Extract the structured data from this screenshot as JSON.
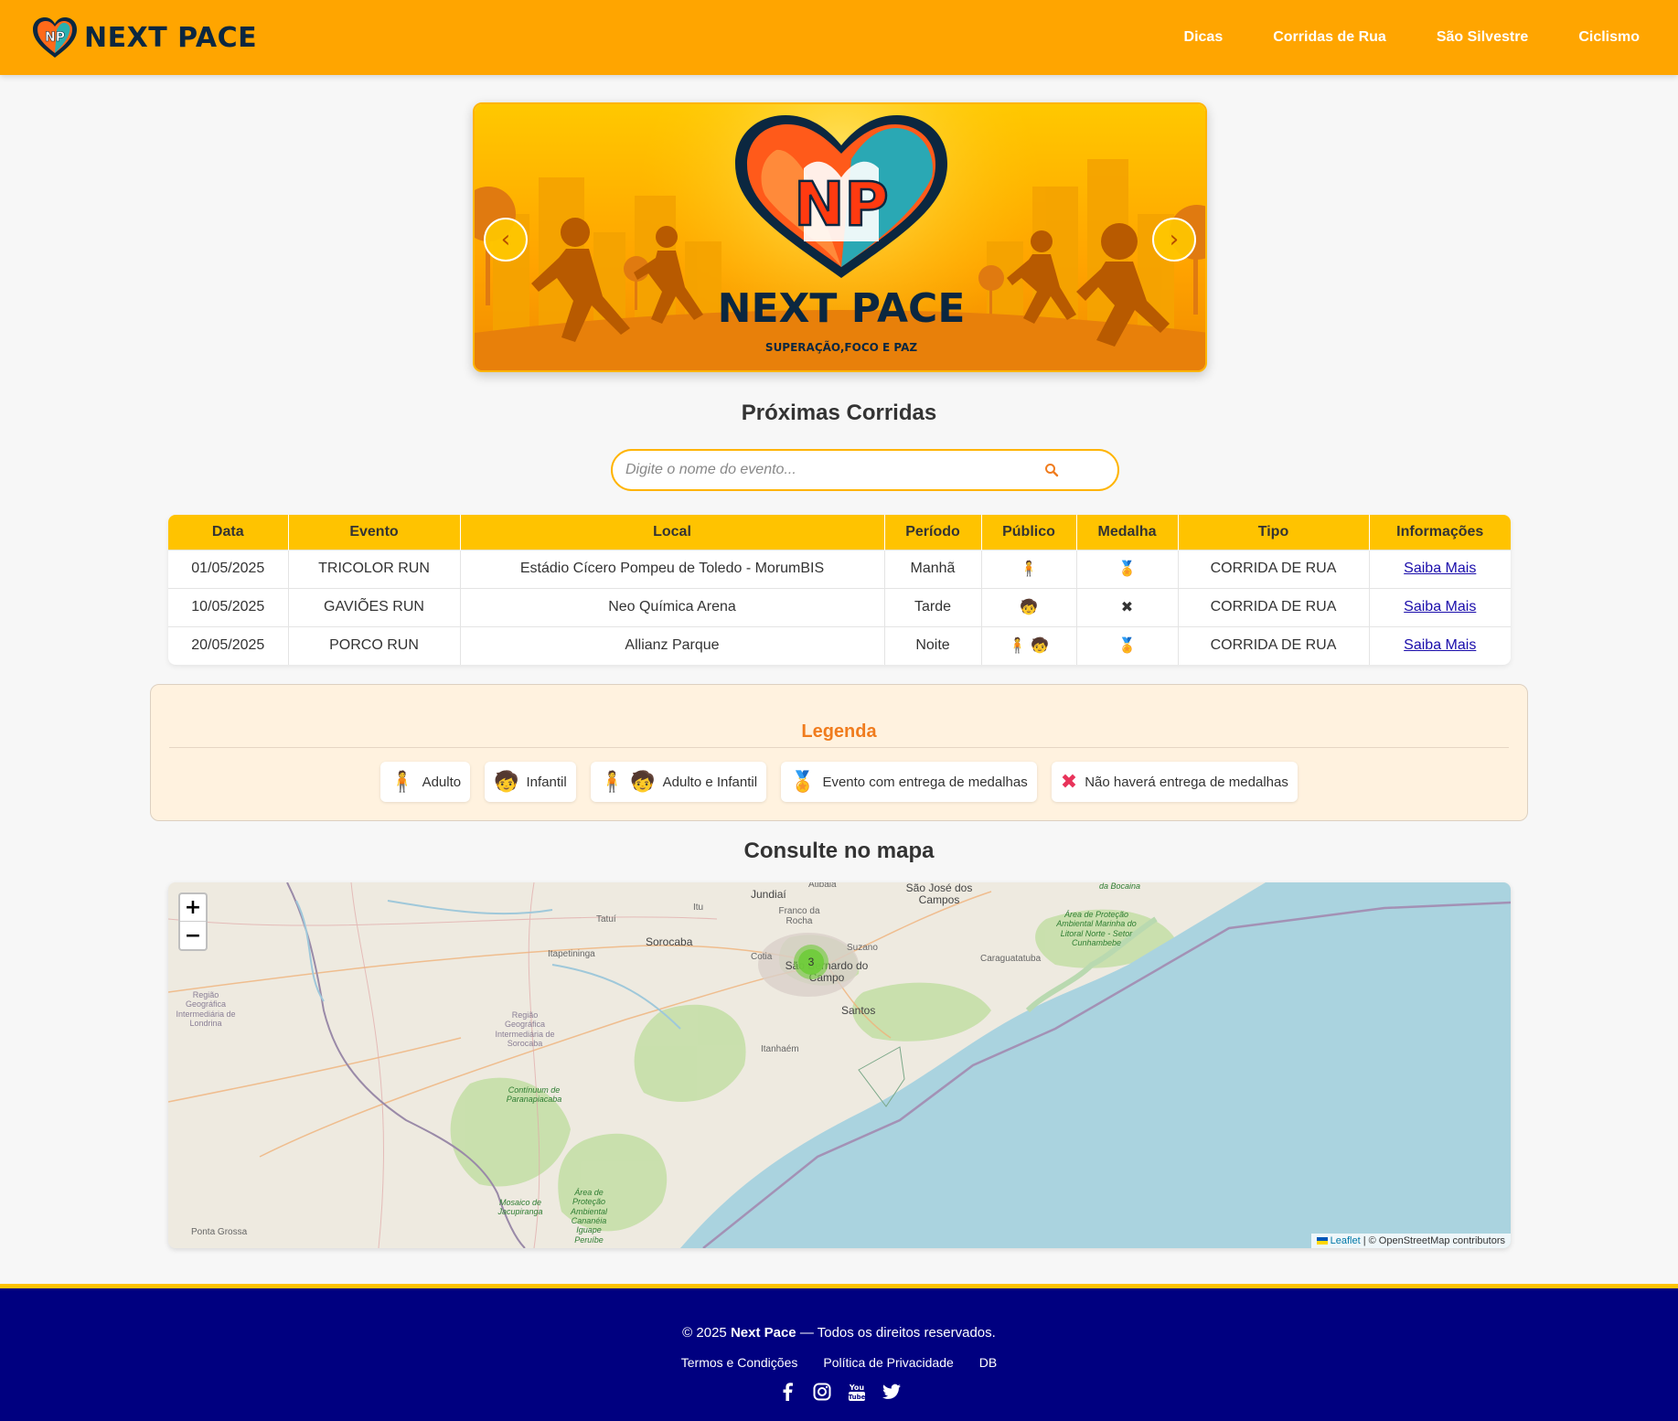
{
  "header": {
    "brand_name": "NEXT PACE",
    "nav": [
      "Dicas",
      "Corridas de Rua",
      "São Silvestre",
      "Ciclismo"
    ]
  },
  "banner": {
    "initials": "NP",
    "title": "NEXT PACE",
    "tagline": "SUPERAÇÃO,FOCO E PAZ",
    "prev": "‹",
    "next": "›"
  },
  "races_section": {
    "title": "Próximas Corridas",
    "search_placeholder": "Digite o nome do evento...",
    "columns": [
      "Data",
      "Evento",
      "Local",
      "Período",
      "Público",
      "Medalha",
      "Tipo",
      "Informações"
    ],
    "rows": [
      {
        "data": "01/05/2025",
        "evento": "TRICOLOR RUN",
        "local": "Estádio Cícero Pompeu de Toledo - MorumBIS",
        "periodo": "Manhã",
        "publico": "🧍",
        "medalha": "🏅",
        "tipo": "CORRIDA DE RUA",
        "info": "Saiba Mais"
      },
      {
        "data": "10/05/2025",
        "evento": "GAVIÕES RUN",
        "local": "Neo Química Arena",
        "periodo": "Tarde",
        "publico": "🧒",
        "medalha": "✖",
        "tipo": "CORRIDA DE RUA",
        "info": "Saiba Mais"
      },
      {
        "data": "20/05/2025",
        "evento": "PORCO RUN",
        "local": "Allianz Parque",
        "periodo": "Noite",
        "publico": "🧍 🧒",
        "medalha": "🏅",
        "tipo": "CORRIDA DE RUA",
        "info": "Saiba Mais"
      }
    ]
  },
  "legend": {
    "title": "Legenda",
    "items": [
      {
        "icon": "🧍",
        "label": "Adulto"
      },
      {
        "icon": "🧒",
        "label": "Infantil"
      },
      {
        "icon": "🧍 🧒",
        "label": "Adulto e Infantil"
      },
      {
        "icon": "🏅",
        "label": "Evento com entrega de medalhas"
      },
      {
        "icon": "✖",
        "label": "Não haverá entrega de medalhas"
      }
    ]
  },
  "map_section": {
    "title": "Consulte no mapa",
    "zoom_in": "+",
    "zoom_out": "−",
    "cluster_count": "3",
    "attribution_link": "Leaflet",
    "attribution_text": "| © OpenStreetMap contributors",
    "labels": {
      "jundiai": "Jundiaí",
      "sjcampos": "São José dos Campos",
      "sorocaba": "Sorocaba",
      "sbcampo": "São Bernardo do Campo",
      "santos": "Santos",
      "itanhaem": "Itanhaém",
      "caraguatatuba": "Caraguatatuba",
      "itapetininga": "Itapetininga",
      "tatui": "Tatuí",
      "itu": "Itu",
      "atibaia": "Atibaia",
      "cotia": "Cotia",
      "suzano": "Suzano",
      "francorocha": "Franco da Rocha",
      "pontagrossa": "Ponta Grossa",
      "londrina": "Região Geográfica Intermediária de Londrina",
      "regsorocaba": "Região Geográfica Intermediária de Sorocaba",
      "paranapiacaba": "Contínuum de Paranapiacaba",
      "litoralnorte": "Área de Proteção Ambiental Marinha do Litoral Norte - Setor Cunhambebe",
      "bocaina": "da Bocaina",
      "jacupiranga": "Mosaico de Jacupiranga",
      "iguape": "Área de Proteção Ambiental Cananéia Iguape Peruíbe"
    }
  },
  "footer": {
    "copy_prefix": "© 2025",
    "copy_brand": "Next Pace",
    "copy_suffix": "— Todos os direitos reservados.",
    "links": [
      "Termos e Condições",
      "Política de Privacidade",
      "DB"
    ]
  },
  "colors": {
    "header": "#ffa500",
    "table_header": "#ffc300",
    "legend_title": "#f07c1e",
    "footer": "#000080"
  }
}
